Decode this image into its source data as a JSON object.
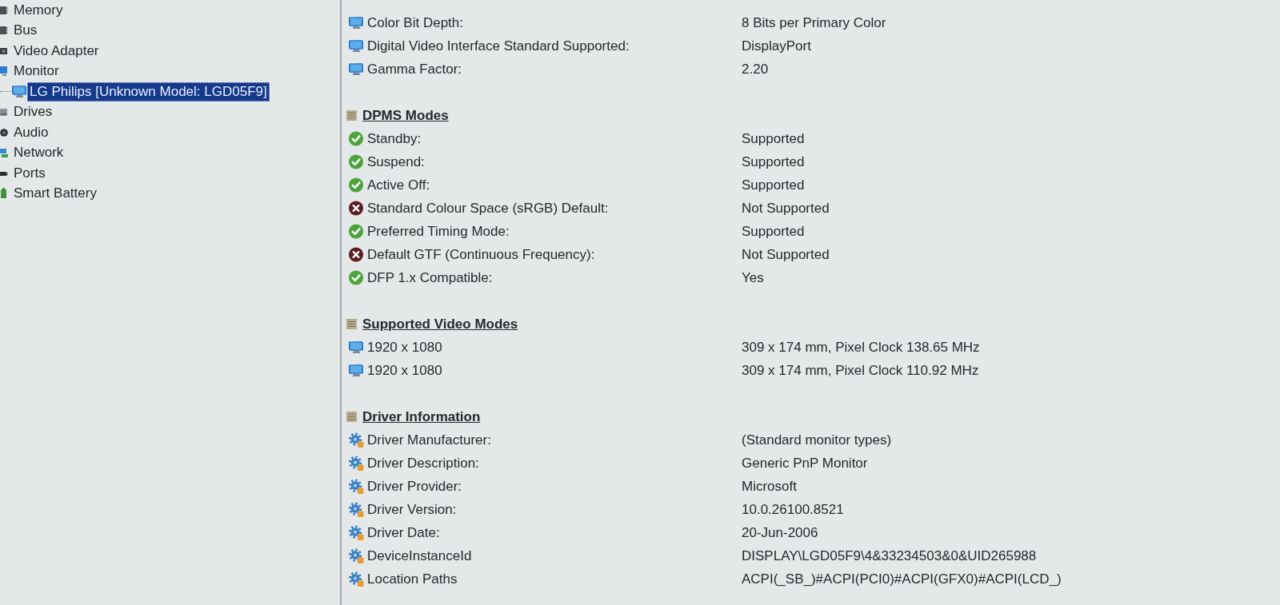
{
  "tree": {
    "items": [
      {
        "kind": "memory",
        "label": "Memory",
        "selected": false
      },
      {
        "kind": "bus",
        "label": "Bus",
        "selected": false
      },
      {
        "kind": "video",
        "label": "Video Adapter",
        "selected": false
      },
      {
        "kind": "monitor",
        "label": "Monitor",
        "selected": false,
        "children": [
          {
            "kind": "display",
            "label": "LG Philips [Unknown Model: LGD05F9]",
            "selected": true
          }
        ]
      },
      {
        "kind": "drives",
        "label": "Drives",
        "selected": false
      },
      {
        "kind": "audio",
        "label": "Audio",
        "selected": false
      },
      {
        "kind": "network",
        "label": "Network",
        "selected": false
      },
      {
        "kind": "ports",
        "label": "Ports",
        "selected": false
      },
      {
        "kind": "battery",
        "label": "Smart Battery",
        "selected": false
      }
    ]
  },
  "details": {
    "sections": [
      {
        "rows": [
          {
            "kind": "display",
            "label": "Color Bit Depth:",
            "value": "8 Bits per Primary Color"
          },
          {
            "kind": "display",
            "label": "Digital Video Interface Standard Supported:",
            "value": "DisplayPort"
          },
          {
            "kind": "display",
            "label": "Gamma Factor:",
            "value": "2.20"
          }
        ]
      },
      {
        "title": "DPMS Modes",
        "rows": [
          {
            "kind": "supported",
            "label": "Standby:",
            "value": "Supported"
          },
          {
            "kind": "supported",
            "label": "Suspend:",
            "value": "Supported"
          },
          {
            "kind": "supported",
            "label": "Active Off:",
            "value": "Supported"
          },
          {
            "kind": "unsupported",
            "label": "Standard Colour Space (sRGB) Default:",
            "value": "Not Supported"
          },
          {
            "kind": "supported",
            "label": "Preferred Timing Mode:",
            "value": "Supported"
          },
          {
            "kind": "unsupported",
            "label": "Default GTF (Continuous Frequency):",
            "value": "Not Supported"
          },
          {
            "kind": "supported",
            "label": "DFP 1.x Compatible:",
            "value": "Yes"
          }
        ]
      },
      {
        "title": "Supported Video Modes",
        "rows": [
          {
            "kind": "display",
            "label": "1920 x 1080",
            "value": "309 x 174 mm, Pixel Clock 138.65 MHz"
          },
          {
            "kind": "display",
            "label": "1920 x 1080",
            "value": "309 x 174 mm, Pixel Clock 110.92 MHz"
          }
        ]
      },
      {
        "title": "Driver Information",
        "rows": [
          {
            "kind": "driver",
            "label": "Driver Manufacturer:",
            "value": "(Standard monitor types)"
          },
          {
            "kind": "driver",
            "label": "Driver Description:",
            "value": "Generic PnP Monitor"
          },
          {
            "kind": "driver",
            "label": "Driver Provider:",
            "value": "Microsoft"
          },
          {
            "kind": "driver",
            "label": "Driver Version:",
            "value": "10.0.26100.8521"
          },
          {
            "kind": "driver",
            "label": "Driver Date:",
            "value": "20-Jun-2006"
          },
          {
            "kind": "driver",
            "label": "DeviceInstanceId",
            "value": "DISPLAY\\LGD05F9\\4&33234503&0&UID265988"
          },
          {
            "kind": "driver",
            "label": "Location Paths",
            "value": "ACPI(_SB_)#ACPI(PCI0)#ACPI(GFX0)#ACPI(LCD_)"
          }
        ]
      }
    ]
  }
}
